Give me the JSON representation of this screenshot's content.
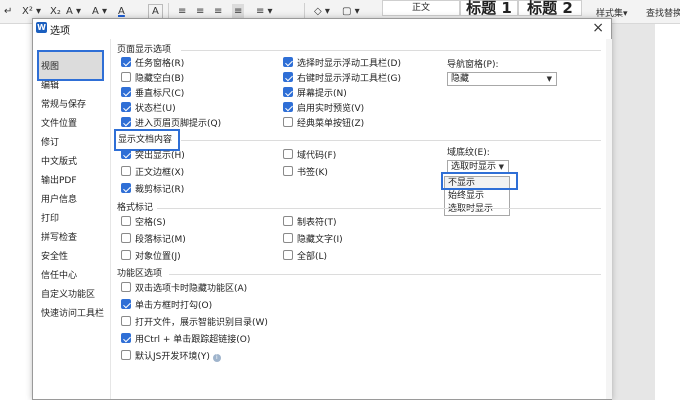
{
  "ribbon": {
    "items": [
      "↵ ",
      "X² ▾",
      "X₂",
      "A ▾",
      "A ▾",
      "A"
    ],
    "align_icons": [
      "≡",
      "≡",
      "≡",
      "≡",
      "≡ ▾"
    ],
    "shading_icons": [
      "◇ ▾",
      "▢ ▾"
    ],
    "styles": [
      "正文",
      "标题 1",
      "标题 2"
    ],
    "style_set": "样式集▾",
    "find_replace": "查找替换"
  },
  "dialog": {
    "app_logo": "W",
    "title": "选项",
    "close": "×"
  },
  "nav": {
    "items": [
      "视图",
      "编辑",
      "常规与保存",
      "文件位置",
      "修订",
      "中文版式",
      "输出PDF",
      "用户信息",
      "打印",
      "拼写检查",
      "安全性",
      "信任中心",
      "自定义功能区",
      "快速访问工具栏"
    ],
    "selected": "视图"
  },
  "page_display": {
    "title": "页面显示选项",
    "col1": [
      {
        "label": "任务窗格(R)",
        "checked": true
      },
      {
        "label": "隐藏空白(B)",
        "checked": false
      },
      {
        "label": "垂直标尺(C)",
        "checked": true
      },
      {
        "label": "状态栏(U)",
        "checked": true
      },
      {
        "label": "进入页眉页脚提示(Q)",
        "checked": true
      }
    ],
    "col2": [
      {
        "label": "选择时显示浮动工具栏(D)",
        "checked": true
      },
      {
        "label": "右键时显示浮动工具栏(G)",
        "checked": true
      },
      {
        "label": "屏幕提示(N)",
        "checked": true
      },
      {
        "label": "启用实时预览(V)",
        "checked": true
      },
      {
        "label": "经典菜单按钮(Z)",
        "checked": false
      }
    ],
    "nav_pane_label": "导航窗格(P):",
    "nav_pane_value": "隐藏"
  },
  "show_doc": {
    "title": "显示文档内容",
    "col1": [
      {
        "label": "突出显示(H)",
        "checked": true
      },
      {
        "label": "正文边框(X)",
        "checked": false
      },
      {
        "label": "裁剪标记(R)",
        "checked": true
      }
    ],
    "col2": [
      {
        "label": "域代码(F)",
        "checked": false
      },
      {
        "label": "书签(K)",
        "checked": false
      }
    ],
    "field_shading_label": "域底纹(E):",
    "field_shading_value": "选取时显示",
    "field_shading_options": [
      "不显示",
      "始终显示",
      "选取时显示"
    ]
  },
  "format_marks": {
    "title": "格式标记",
    "col1": [
      {
        "label": "空格(S)",
        "checked": false
      },
      {
        "label": "段落标记(M)",
        "checked": false
      },
      {
        "label": "对象位置(J)",
        "checked": false
      }
    ],
    "col2": [
      {
        "label": "制表符(T)",
        "checked": false
      },
      {
        "label": "隐藏文字(I)",
        "checked": false
      },
      {
        "label": "全部(L)",
        "checked": false
      }
    ]
  },
  "ribbon_options": {
    "title": "功能区选项",
    "items": [
      {
        "label": "双击选项卡时隐藏功能区(A)",
        "checked": false
      },
      {
        "label": "单击方框时打勾(O)",
        "checked": true
      },
      {
        "label": "打开文件，展示智能识别目录(W)",
        "checked": false
      },
      {
        "label": "用Ctrl + 单击跟踪超链接(O)",
        "checked": true
      },
      {
        "label": "默认JS开发环境(Y)",
        "checked": false
      }
    ],
    "info_icon": "i"
  },
  "colors": {
    "accent": "#2f6fd6",
    "nav_selected_bg": "#dcdcdc"
  }
}
